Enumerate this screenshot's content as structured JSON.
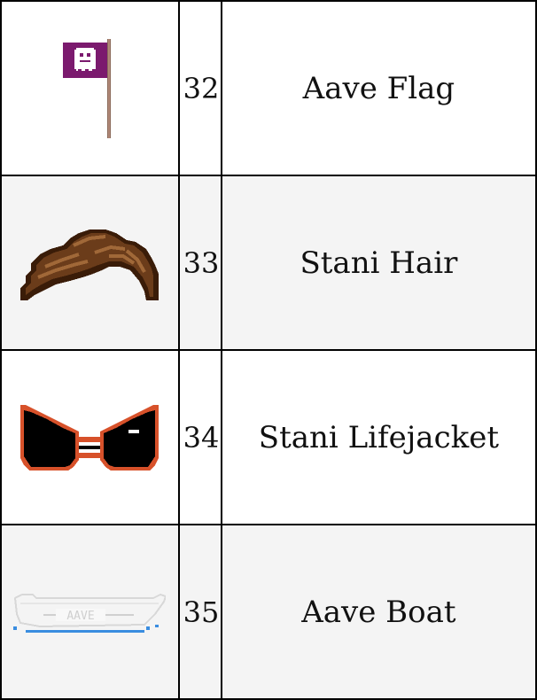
{
  "table": {
    "rows": [
      {
        "id": "32",
        "name": "Aave Flag",
        "icon": "aave-flag-icon"
      },
      {
        "id": "33",
        "name": "Stani Hair",
        "icon": "stani-hair-icon"
      },
      {
        "id": "34",
        "name": "Stani Lifejacket",
        "icon": "stani-lifejacket-icon"
      },
      {
        "id": "35",
        "name": "Aave Boat",
        "icon": "aave-boat-icon",
        "icon_text": "AAVE"
      }
    ]
  },
  "colors": {
    "row_alt_bg": "#f4f4f4",
    "flag_purple": "#7b1a6e",
    "hair_brown": "#5a3418",
    "jacket_orange": "#e0522a",
    "boat_blue": "#3a8de0"
  }
}
